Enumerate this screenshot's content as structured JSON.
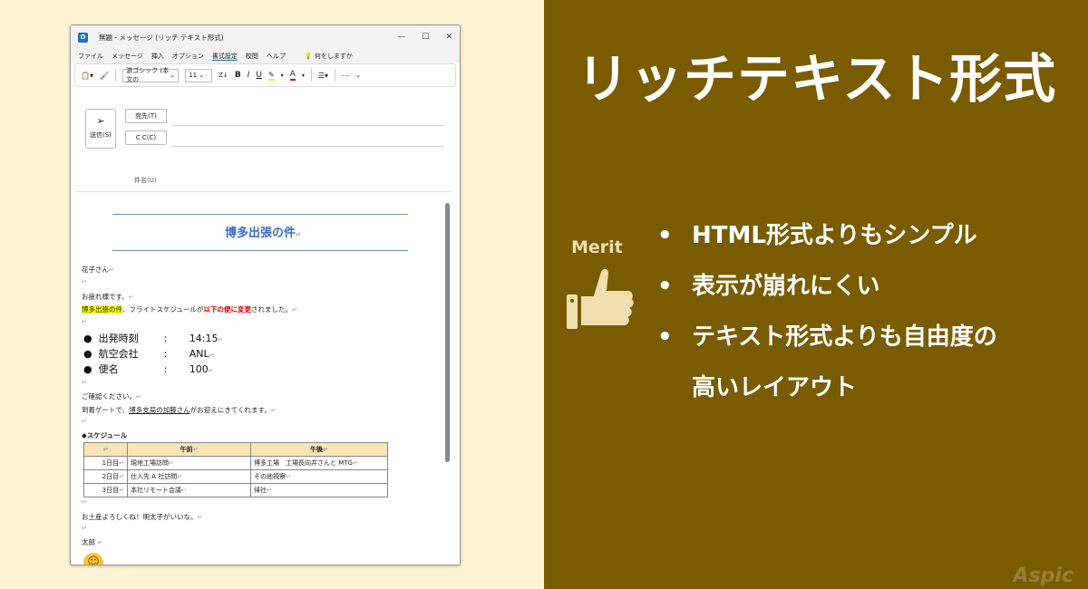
{
  "window": {
    "title": "無題 - メッセージ (リッチ テキスト形式)",
    "controls": [
      "—",
      "☐",
      "✕"
    ]
  },
  "menu": {
    "items": [
      "ファイル",
      "メッセージ",
      "挿入",
      "オプション",
      "書式設定",
      "校閲",
      "ヘルプ"
    ],
    "active_index": 4,
    "search_hint": "何をしますか"
  },
  "toolbar": {
    "font_name": "游ゴシック (本文の",
    "font_size": "11",
    "bold": "B",
    "italic": "I",
    "underline": "U",
    "font_color": "A",
    "more": "⋯"
  },
  "compose": {
    "send_label": "送信(S)",
    "to_label": "宛先(T)",
    "cc_label": "C C(C)",
    "subject_label": "件名(U)"
  },
  "email": {
    "subject": "博多出張の件",
    "greeting": "花子さん",
    "intro": "お疲れ様です。",
    "highlight_text": "博多出張の件",
    "line2_mid": "、フライトスケジュールが",
    "red_text": "以下の便に変更",
    "line2_end": "されました。",
    "flight": [
      {
        "label": "出発時刻",
        "value": "14:15"
      },
      {
        "label": "航空会社",
        "value": "ANL"
      },
      {
        "label": "便名",
        "value": "100"
      }
    ],
    "confirm": "ご確認ください。",
    "arrival_pre": "到着ゲートで、",
    "arrival_u": "博多支局の加藤さん",
    "arrival_post": "がお迎えにきてくれます。",
    "schedule_title": "◆スケジュール",
    "schedule_headers": [
      "",
      "午前",
      "午後"
    ],
    "schedule_rows": [
      [
        "1日目",
        "現地工場訪問",
        "博多工場　工場長向井さんと MTG"
      ],
      [
        "2日目",
        "仕入先 A 社訪問",
        "その他視察"
      ],
      [
        "3日目",
        "本社リモート会議",
        "帰社"
      ]
    ],
    "closing": "お土産よろしくね！明太子がいいな。",
    "signature": "太郎",
    "return_mark": "↵"
  },
  "right": {
    "title": "リッチテキスト形式",
    "merit_label": "Merit",
    "merits": [
      "HTML形式よりもシンプル",
      "表示が崩れにくい",
      "テキスト形式よりも自由度の",
      "高いレイアウト"
    ],
    "bullet": "•",
    "brand": "Aspic"
  },
  "colors": {
    "left_bg": "#fff3d4",
    "right_bg": "#7a5c00",
    "subject_blue": "#3b6ec5",
    "highlight": "#ffff00",
    "red": "#e00000",
    "table_header": "#fbe4b4"
  }
}
